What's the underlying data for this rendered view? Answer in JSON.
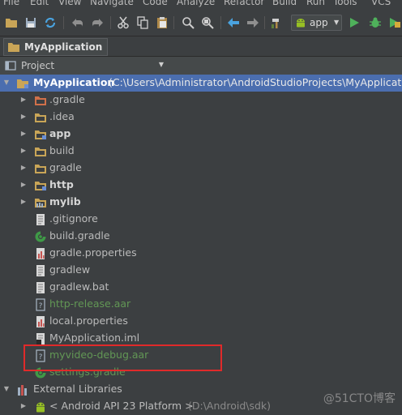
{
  "menu": [
    {
      "label": "File"
    },
    {
      "label": "Edit"
    },
    {
      "label": "View"
    },
    {
      "label": "Navigate"
    },
    {
      "label": "Code"
    },
    {
      "label": "Analyze"
    },
    {
      "label": "Refactor"
    },
    {
      "label": "Build"
    },
    {
      "label": "Run"
    },
    {
      "label": "Tools"
    },
    {
      "label": "VCS"
    }
  ],
  "toolbar": {
    "run_config": "app"
  },
  "navbar": {
    "crumb": "MyApplication"
  },
  "panel": {
    "view_mode": "Project"
  },
  "tree": {
    "root": {
      "name": "MyApplication",
      "path": "(C:\\Users\\Administrator\\AndroidStudioProjects\\MyApplication"
    },
    "items": [
      {
        "label": ".gradle"
      },
      {
        "label": ".idea"
      },
      {
        "label": "app"
      },
      {
        "label": "build"
      },
      {
        "label": "gradle"
      },
      {
        "label": "http"
      },
      {
        "label": "mylib"
      },
      {
        "label": ".gitignore"
      },
      {
        "label": "build.gradle"
      },
      {
        "label": "gradle.properties"
      },
      {
        "label": "gradlew"
      },
      {
        "label": "gradlew.bat"
      },
      {
        "label": "http-release.aar"
      },
      {
        "label": "local.properties"
      },
      {
        "label": "MyApplication.iml"
      },
      {
        "label": "myvideo-debug.aar"
      },
      {
        "label": "settings.gradle"
      }
    ],
    "external": {
      "label": "External Libraries"
    },
    "sdk": {
      "name": "< Android API 23 Platform >",
      "path": "(D:\\Android\\sdk)"
    }
  },
  "watermark": "@51CTO博客"
}
